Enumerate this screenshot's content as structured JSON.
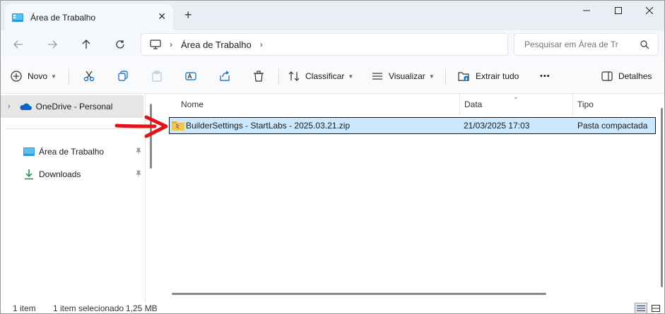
{
  "window": {
    "tab_title": "Área de Trabalho",
    "new_tab_symbol": "+",
    "close_tab_symbol": "✕"
  },
  "address": {
    "breadcrumb": [
      "Área de Trabalho"
    ],
    "search_placeholder": "Pesquisar em Área de Tr"
  },
  "toolbar": {
    "new_label": "Novo",
    "sort_label": "Classificar",
    "view_label": "Visualizar",
    "extract_label": "Extrair tudo",
    "more_label": "•••",
    "details_label": "Detalhes"
  },
  "sidebar": {
    "onedrive_label": "OneDrive - Personal",
    "items": [
      {
        "label": "Área de Trabalho",
        "icon": "desktop-icon"
      },
      {
        "label": "Downloads",
        "icon": "download-icon"
      }
    ]
  },
  "file_list": {
    "columns": [
      "Nome",
      "Data",
      "Tipo"
    ],
    "rows": [
      {
        "name": "BuilderSettings - StartLabs - 2025.03.21.zip",
        "date": "21/03/2025 17:03",
        "type": "Pasta compactada",
        "selected": true
      }
    ]
  },
  "status": {
    "item_count": "1 item",
    "selection": "1 item selecionado",
    "size": "1,25 MB"
  },
  "colors": {
    "accent": "#0067c0",
    "selection": "#cce8ff",
    "annotation_arrow": "#e0141b"
  }
}
